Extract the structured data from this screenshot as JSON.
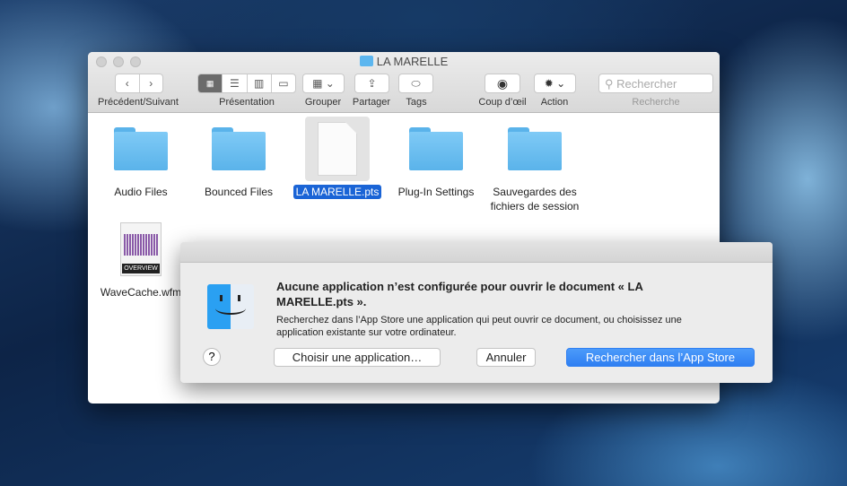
{
  "window": {
    "title": "LA MARELLE"
  },
  "toolbar": {
    "nav_label": "Précédent/Suivant",
    "view_label": "Présentation",
    "group_label": "Grouper",
    "share_label": "Partager",
    "tags_label": "Tags",
    "quicklook_label": "Coup d’œil",
    "action_label": "Action",
    "search_placeholder": "Rechercher",
    "search_label": "Recherche",
    "selected_view": "icons"
  },
  "files": [
    {
      "name": "Audio Files",
      "type": "folder"
    },
    {
      "name": "Bounced Files",
      "type": "folder"
    },
    {
      "name": "LA MARELLE.pts",
      "type": "document",
      "selected": true
    },
    {
      "name": "Plug-In Settings",
      "type": "folder"
    },
    {
      "name": "Sauvegardes des fichiers de session",
      "type": "folder"
    },
    {
      "name": "WaveCache.wfm",
      "type": "wavecache",
      "badge": "OVERVIEW"
    }
  ],
  "dialog": {
    "title": "Aucune application n’est configurée pour ouvrir le document « LA MARELLE.pts ».",
    "message": "Recherchez dans l’App Store une application qui peut ouvrir ce document, ou choisissez une application existante sur votre ordinateur.",
    "help": "?",
    "choose": "Choisir une application…",
    "cancel": "Annuler",
    "appstore": "Rechercher dans l’App Store"
  },
  "colors": {
    "accent": "#3b8cf7",
    "selection": "#1a64d6"
  }
}
